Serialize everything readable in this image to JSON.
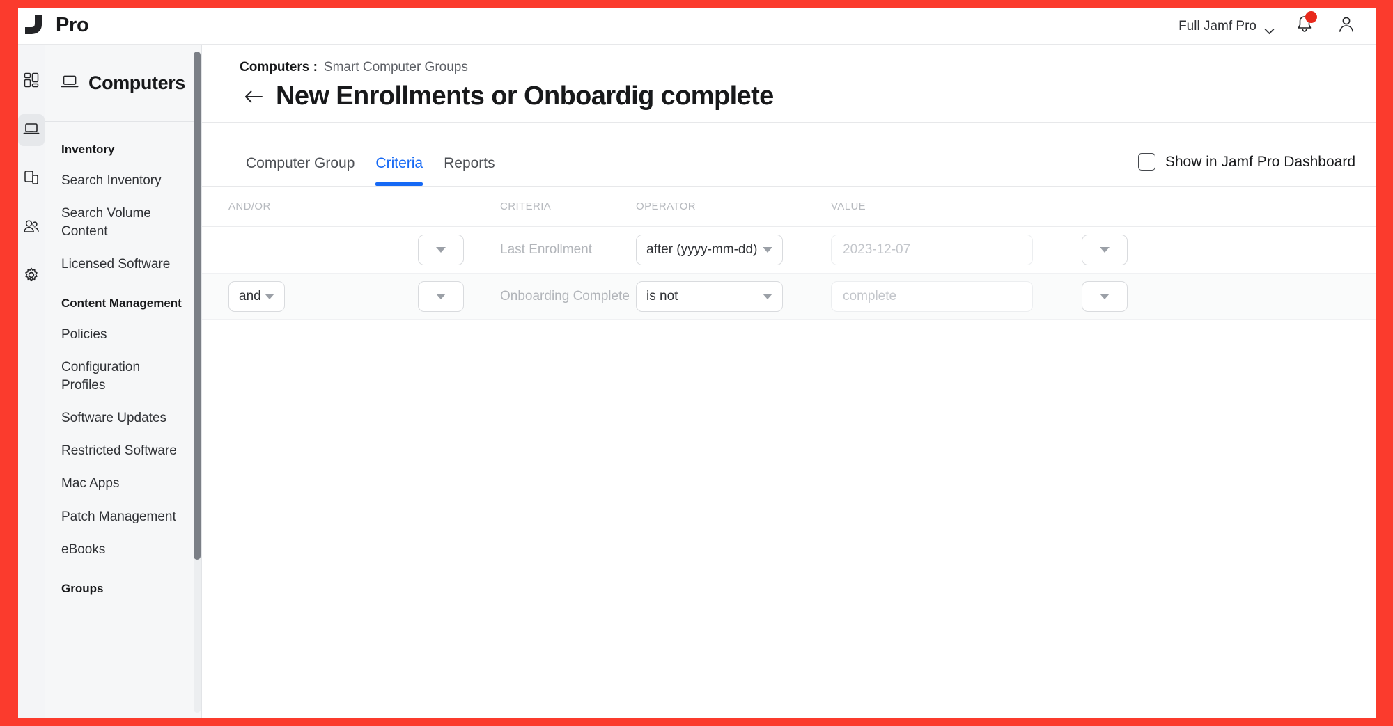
{
  "topbar": {
    "logo_icon": "jamf-logo-icon",
    "product_name": "Pro",
    "context_label": "Full Jamf Pro",
    "chevron_icon": "chevron-down-icon",
    "notifications_icon": "bell-icon",
    "notification_badge": "",
    "account_icon": "user-avatar-icon"
  },
  "rail": {
    "items": [
      {
        "name": "dashboard",
        "icon": "grid-dashboard-icon",
        "active": false
      },
      {
        "name": "computers",
        "icon": "laptop-icon",
        "active": true
      },
      {
        "name": "devices",
        "icon": "mobile-devices-icon",
        "active": false
      },
      {
        "name": "users",
        "icon": "users-icon",
        "active": false
      },
      {
        "name": "settings",
        "icon": "gear-icon",
        "active": false
      }
    ]
  },
  "sidebar": {
    "header_icon": "laptop-icon",
    "header_title": "Computers",
    "sections": [
      {
        "label": "Inventory",
        "items": [
          "Search Inventory",
          "Search Volume Content",
          "Licensed Software"
        ]
      },
      {
        "label": "Content Management",
        "items": [
          "Policies",
          "Configuration Profiles",
          "Software Updates",
          "Restricted Software",
          "Mac Apps",
          "Patch Management",
          "eBooks"
        ]
      },
      {
        "label": "Groups",
        "items": []
      }
    ]
  },
  "page": {
    "breadcrumb_root": "Computers :",
    "breadcrumb_current": "Smart Computer Groups",
    "back_icon": "back-arrow-icon",
    "title": "New Enrollments or Onboardig complete"
  },
  "tabs": [
    {
      "label": "Computer Group",
      "active": false
    },
    {
      "label": "Criteria",
      "active": true
    },
    {
      "label": "Reports",
      "active": false
    }
  ],
  "dashboard_toggle": {
    "label": "Show in Jamf Pro Dashboard",
    "checked": false,
    "icon": "checkbox-icon"
  },
  "criteria_table": {
    "headers": {
      "andor": "AND/OR",
      "remove": "",
      "criteria": "CRITERIA",
      "operator": "OPERATOR",
      "value": "VALUE",
      "more": ""
    },
    "rows": [
      {
        "andor": "",
        "remove": "",
        "criteria": "Last Enrollment",
        "operator": "after (yyyy-mm-dd)",
        "value": "2023-12-07",
        "more": ""
      },
      {
        "andor": "and",
        "remove": "",
        "criteria": "Onboarding Complete",
        "operator": "is not",
        "value": "complete",
        "more": ""
      }
    ]
  },
  "colors": {
    "frame": "#fb3b2d",
    "accent": "#1669f5",
    "badge": "#e8291c",
    "sidebar_bg": "#f6f7f8"
  }
}
